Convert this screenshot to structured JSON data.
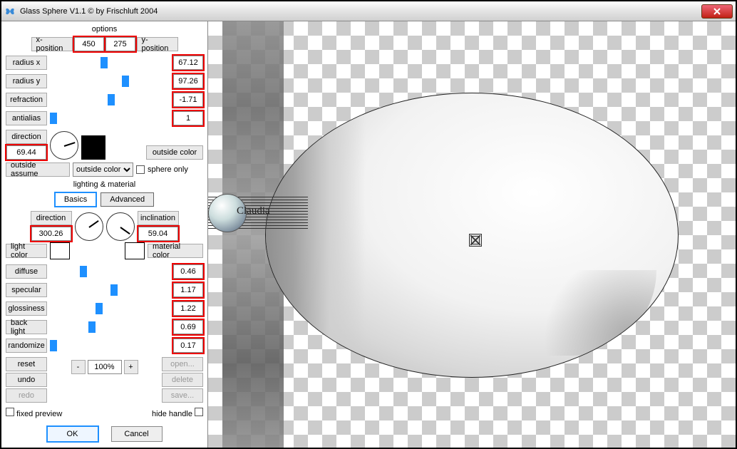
{
  "title": "Glass Sphere V1.1 © by Frischluft 2004",
  "icon": "butterfly-icon",
  "options_label": "options",
  "xpos": {
    "label": "x-position",
    "value": "450"
  },
  "ypos": {
    "label": "y-position",
    "value": "275"
  },
  "sliders": {
    "radius_x": {
      "label": "radius x",
      "value": "67.12",
      "pos": 42
    },
    "radius_y": {
      "label": "radius y",
      "value": "97.26",
      "pos": 60
    },
    "refraction": {
      "label": "refraction",
      "value": "-1.71",
      "pos": 48
    },
    "antialias": {
      "label": "antialias",
      "value": "1",
      "pos": 0
    }
  },
  "direction": {
    "label": "direction",
    "value": "69.44",
    "angle": -18
  },
  "outside_color_label": "outside color",
  "outside_assume_label": "outside assume",
  "outside_select": "outside color",
  "sphere_only_label": "sphere only",
  "section_lm": "lighting & material",
  "tabs": {
    "basics": "Basics",
    "advanced": "Advanced"
  },
  "light": {
    "direction_label": "direction",
    "direction_value": "300.26",
    "direction_angle": -35,
    "inclination_label": "inclination",
    "inclination_value": "59.04",
    "inclination_angle": 35
  },
  "light_color_label": "light color",
  "material_color_label": "material color",
  "mat": {
    "diffuse": {
      "label": "diffuse",
      "value": "0.46",
      "pos": 25
    },
    "specular": {
      "label": "specular",
      "value": "1.17",
      "pos": 50
    },
    "glossiness": {
      "label": "glossiness",
      "value": "1.22",
      "pos": 38
    },
    "back_light": {
      "label": "back light",
      "value": "0.69",
      "pos": 32
    },
    "randomize": {
      "label": "randomize",
      "value": "0.17",
      "pos": 0
    }
  },
  "reset": "reset",
  "undo": "undo",
  "redo": "redo",
  "zoom_minus": "-",
  "zoom_value": "100%",
  "zoom_plus": "+",
  "open": "open...",
  "delete": "delete",
  "save": "save...",
  "fixed_preview": "fixed preview",
  "hide_handle": "hide handle",
  "ok": "OK",
  "cancel": "Cancel",
  "watermark": "Claudia",
  "colors": {
    "outside": "#000000",
    "light": "#ffffff",
    "material": "#ffffff"
  }
}
